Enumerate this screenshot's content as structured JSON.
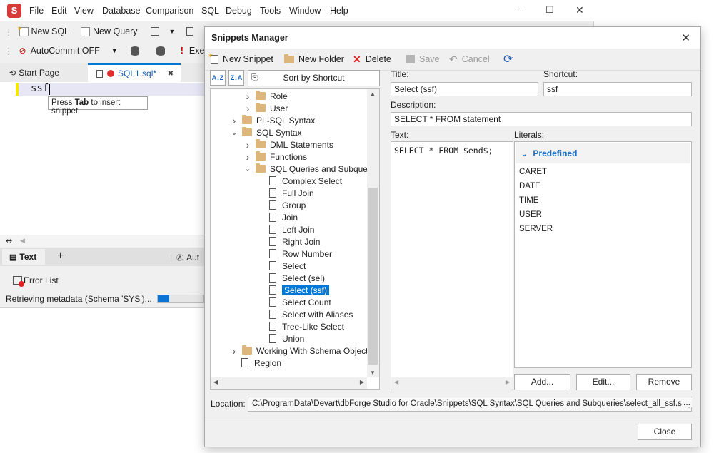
{
  "main": {
    "menu": [
      "File",
      "Edit",
      "View",
      "Database",
      "Comparison",
      "SQL",
      "Debug",
      "Tools",
      "Window",
      "Help"
    ],
    "toolbar1": {
      "new_sql": "New SQL",
      "new_query": "New Query"
    },
    "toolbar2": {
      "autocommit": "AutoCommit OFF",
      "execute": "Exec"
    },
    "tabs": {
      "start_page": "Start Page",
      "sql1": "SQL1.sql*"
    },
    "editor": {
      "text": "ssf",
      "tooltip_pre": "Press ",
      "tooltip_key": "Tab",
      "tooltip_post": " to insert snippet"
    },
    "bottom_tabs": {
      "text": "Text",
      "plus": "+",
      "auto": "Aut"
    },
    "error_list": "Error List",
    "status": "Retrieving metadata (Schema 'SYS')..."
  },
  "dialog": {
    "title": "Snippets Manager",
    "toolbar": {
      "new_snippet": "New Snippet",
      "new_folder": "New Folder",
      "delete": "Delete",
      "save": "Save",
      "cancel": "Cancel"
    },
    "sort_label": "Sort by Shortcut",
    "tree": [
      {
        "label": "Role",
        "type": "folder",
        "level": 1
      },
      {
        "label": "User",
        "type": "folder",
        "level": 1
      },
      {
        "label": "PL-SQL Syntax",
        "type": "folder",
        "level": 0
      },
      {
        "label": "SQL Syntax",
        "type": "folder",
        "level": 0,
        "expanded": true
      },
      {
        "label": "DML Statements",
        "type": "folder",
        "level": 1
      },
      {
        "label": "Functions",
        "type": "folder",
        "level": 1
      },
      {
        "label": "SQL Queries and Subqueries",
        "type": "folder",
        "level": 1,
        "expanded": true
      },
      {
        "label": "Complex Select",
        "type": "snippet",
        "level": 2
      },
      {
        "label": "Full Join",
        "type": "snippet",
        "level": 2
      },
      {
        "label": "Group",
        "type": "snippet",
        "level": 2
      },
      {
        "label": "Join",
        "type": "snippet",
        "level": 2
      },
      {
        "label": "Left Join",
        "type": "snippet",
        "level": 2
      },
      {
        "label": "Right Join",
        "type": "snippet",
        "level": 2
      },
      {
        "label": "Row Number",
        "type": "snippet",
        "level": 2
      },
      {
        "label": "Select",
        "type": "snippet",
        "level": 2
      },
      {
        "label": "Select (sel)",
        "type": "snippet",
        "level": 2
      },
      {
        "label": "Select (ssf)",
        "type": "snippet",
        "level": 2,
        "selected": true
      },
      {
        "label": "Select Count",
        "type": "snippet",
        "level": 2
      },
      {
        "label": "Select with Aliases",
        "type": "snippet",
        "level": 2
      },
      {
        "label": "Tree-Like Select",
        "type": "snippet",
        "level": 2
      },
      {
        "label": "Union",
        "type": "snippet",
        "level": 2
      },
      {
        "label": "Working With Schema Objects",
        "type": "folder",
        "level": 0
      },
      {
        "label": "Region",
        "type": "snippet",
        "level": 0
      }
    ],
    "fields": {
      "title_label": "Title:",
      "title_value": "Select (ssf)",
      "shortcut_label": "Shortcut:",
      "shortcut_value": "ssf",
      "description_label": "Description:",
      "description_value": "SELECT * FROM statement",
      "text_label": "Text:",
      "text_value": "SELECT * FROM $end$;",
      "literals_label": "Literals:"
    },
    "literals": {
      "group": "Predefined",
      "items": [
        "CARET",
        "DATE",
        "TIME",
        "USER",
        "SERVER"
      ]
    },
    "buttons": {
      "add": "Add...",
      "edit": "Edit...",
      "remove": "Remove",
      "close": "Close"
    },
    "location_label": "Location:",
    "location_value": "C:\\ProgramData\\Devart\\dbForge Studio for Oracle\\Snippets\\SQL Syntax\\SQL Queries and Subqueries\\select_all_ssf.snippet",
    "location_more": "..."
  },
  "colors": {
    "selection": "#0078d7",
    "accent": "#1a6fc0",
    "record_dot": "#e02e2e"
  }
}
